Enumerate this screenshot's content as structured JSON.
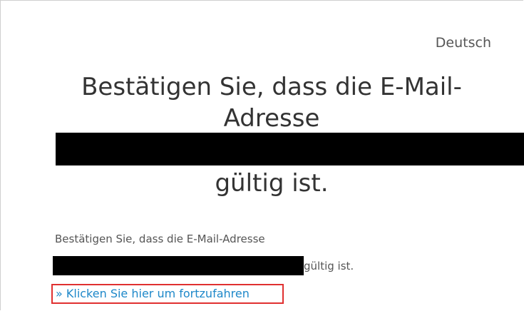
{
  "language": {
    "selected_label": "Deutsch"
  },
  "heading": {
    "line1": "Bestätigen Sie, dass die E-Mail-",
    "line2": "Adresse",
    "end": "gültig ist."
  },
  "body": {
    "intro": "Bestätigen Sie, dass die E-Mail-Adresse",
    "end": "gültig ist."
  },
  "link": {
    "continue_label": "» Klicken Sie hier um fortzufahren"
  },
  "colors": {
    "link": "#1e88c9",
    "highlight_border": "#e03030",
    "redaction": "#000000"
  }
}
